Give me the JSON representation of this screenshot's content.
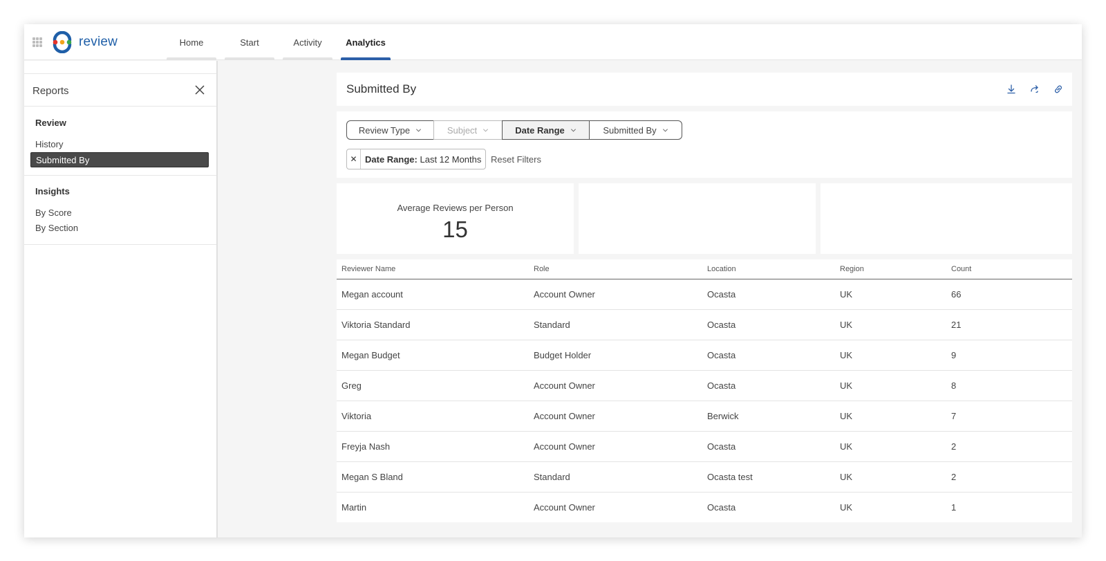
{
  "app": {
    "logo_text": "review"
  },
  "nav": {
    "tabs": [
      {
        "label": "Home"
      },
      {
        "label": "Start"
      },
      {
        "label": "Activity"
      },
      {
        "label": "Analytics",
        "active": true
      }
    ]
  },
  "sidebar": {
    "title": "Reports",
    "sections": [
      {
        "title": "Review",
        "items": [
          {
            "label": "History"
          },
          {
            "label": "Submitted By",
            "selected": true
          }
        ]
      },
      {
        "title": "Insights",
        "items": [
          {
            "label": "By Score"
          },
          {
            "label": "By Section"
          }
        ]
      }
    ]
  },
  "header": {
    "title": "Submitted By",
    "actions": [
      "download-icon",
      "share-icon",
      "link-icon"
    ]
  },
  "filters": {
    "buttons": [
      {
        "label": "Review Type"
      },
      {
        "label": "Subject",
        "disabled": true
      },
      {
        "label": "Date Range",
        "active": true
      },
      {
        "label": "Submitted By"
      }
    ],
    "chip": {
      "key": "Date Range:",
      "value": "Last 12 Months"
    },
    "reset_label": "Reset Filters"
  },
  "stats": {
    "average_label": "Average Reviews per Person",
    "average_value": "15"
  },
  "table": {
    "columns": [
      "Reviewer Name",
      "Role",
      "Location",
      "Region",
      "Count"
    ],
    "rows": [
      [
        "Megan account",
        "Account Owner",
        "Ocasta",
        "UK",
        "66"
      ],
      [
        "Viktoria Standard",
        "Standard",
        "Ocasta",
        "UK",
        "21"
      ],
      [
        "Megan Budget",
        "Budget Holder",
        "Ocasta",
        "UK",
        "9"
      ],
      [
        "Greg",
        "Account Owner",
        "Ocasta",
        "UK",
        "8"
      ],
      [
        "Viktoria",
        "Account Owner",
        "Berwick",
        "UK",
        "7"
      ],
      [
        "Freyja Nash",
        "Account Owner",
        "Ocasta",
        "UK",
        "2"
      ],
      [
        "Megan S Bland",
        "Standard",
        "Ocasta test",
        "UK",
        "2"
      ],
      [
        "Martin",
        "Account Owner",
        "Ocasta",
        "UK",
        "1"
      ]
    ]
  },
  "colors": {
    "accent": "#2c5fa8",
    "selected_item": "#4a4a4a",
    "logo_text": "#1f5fa8"
  }
}
